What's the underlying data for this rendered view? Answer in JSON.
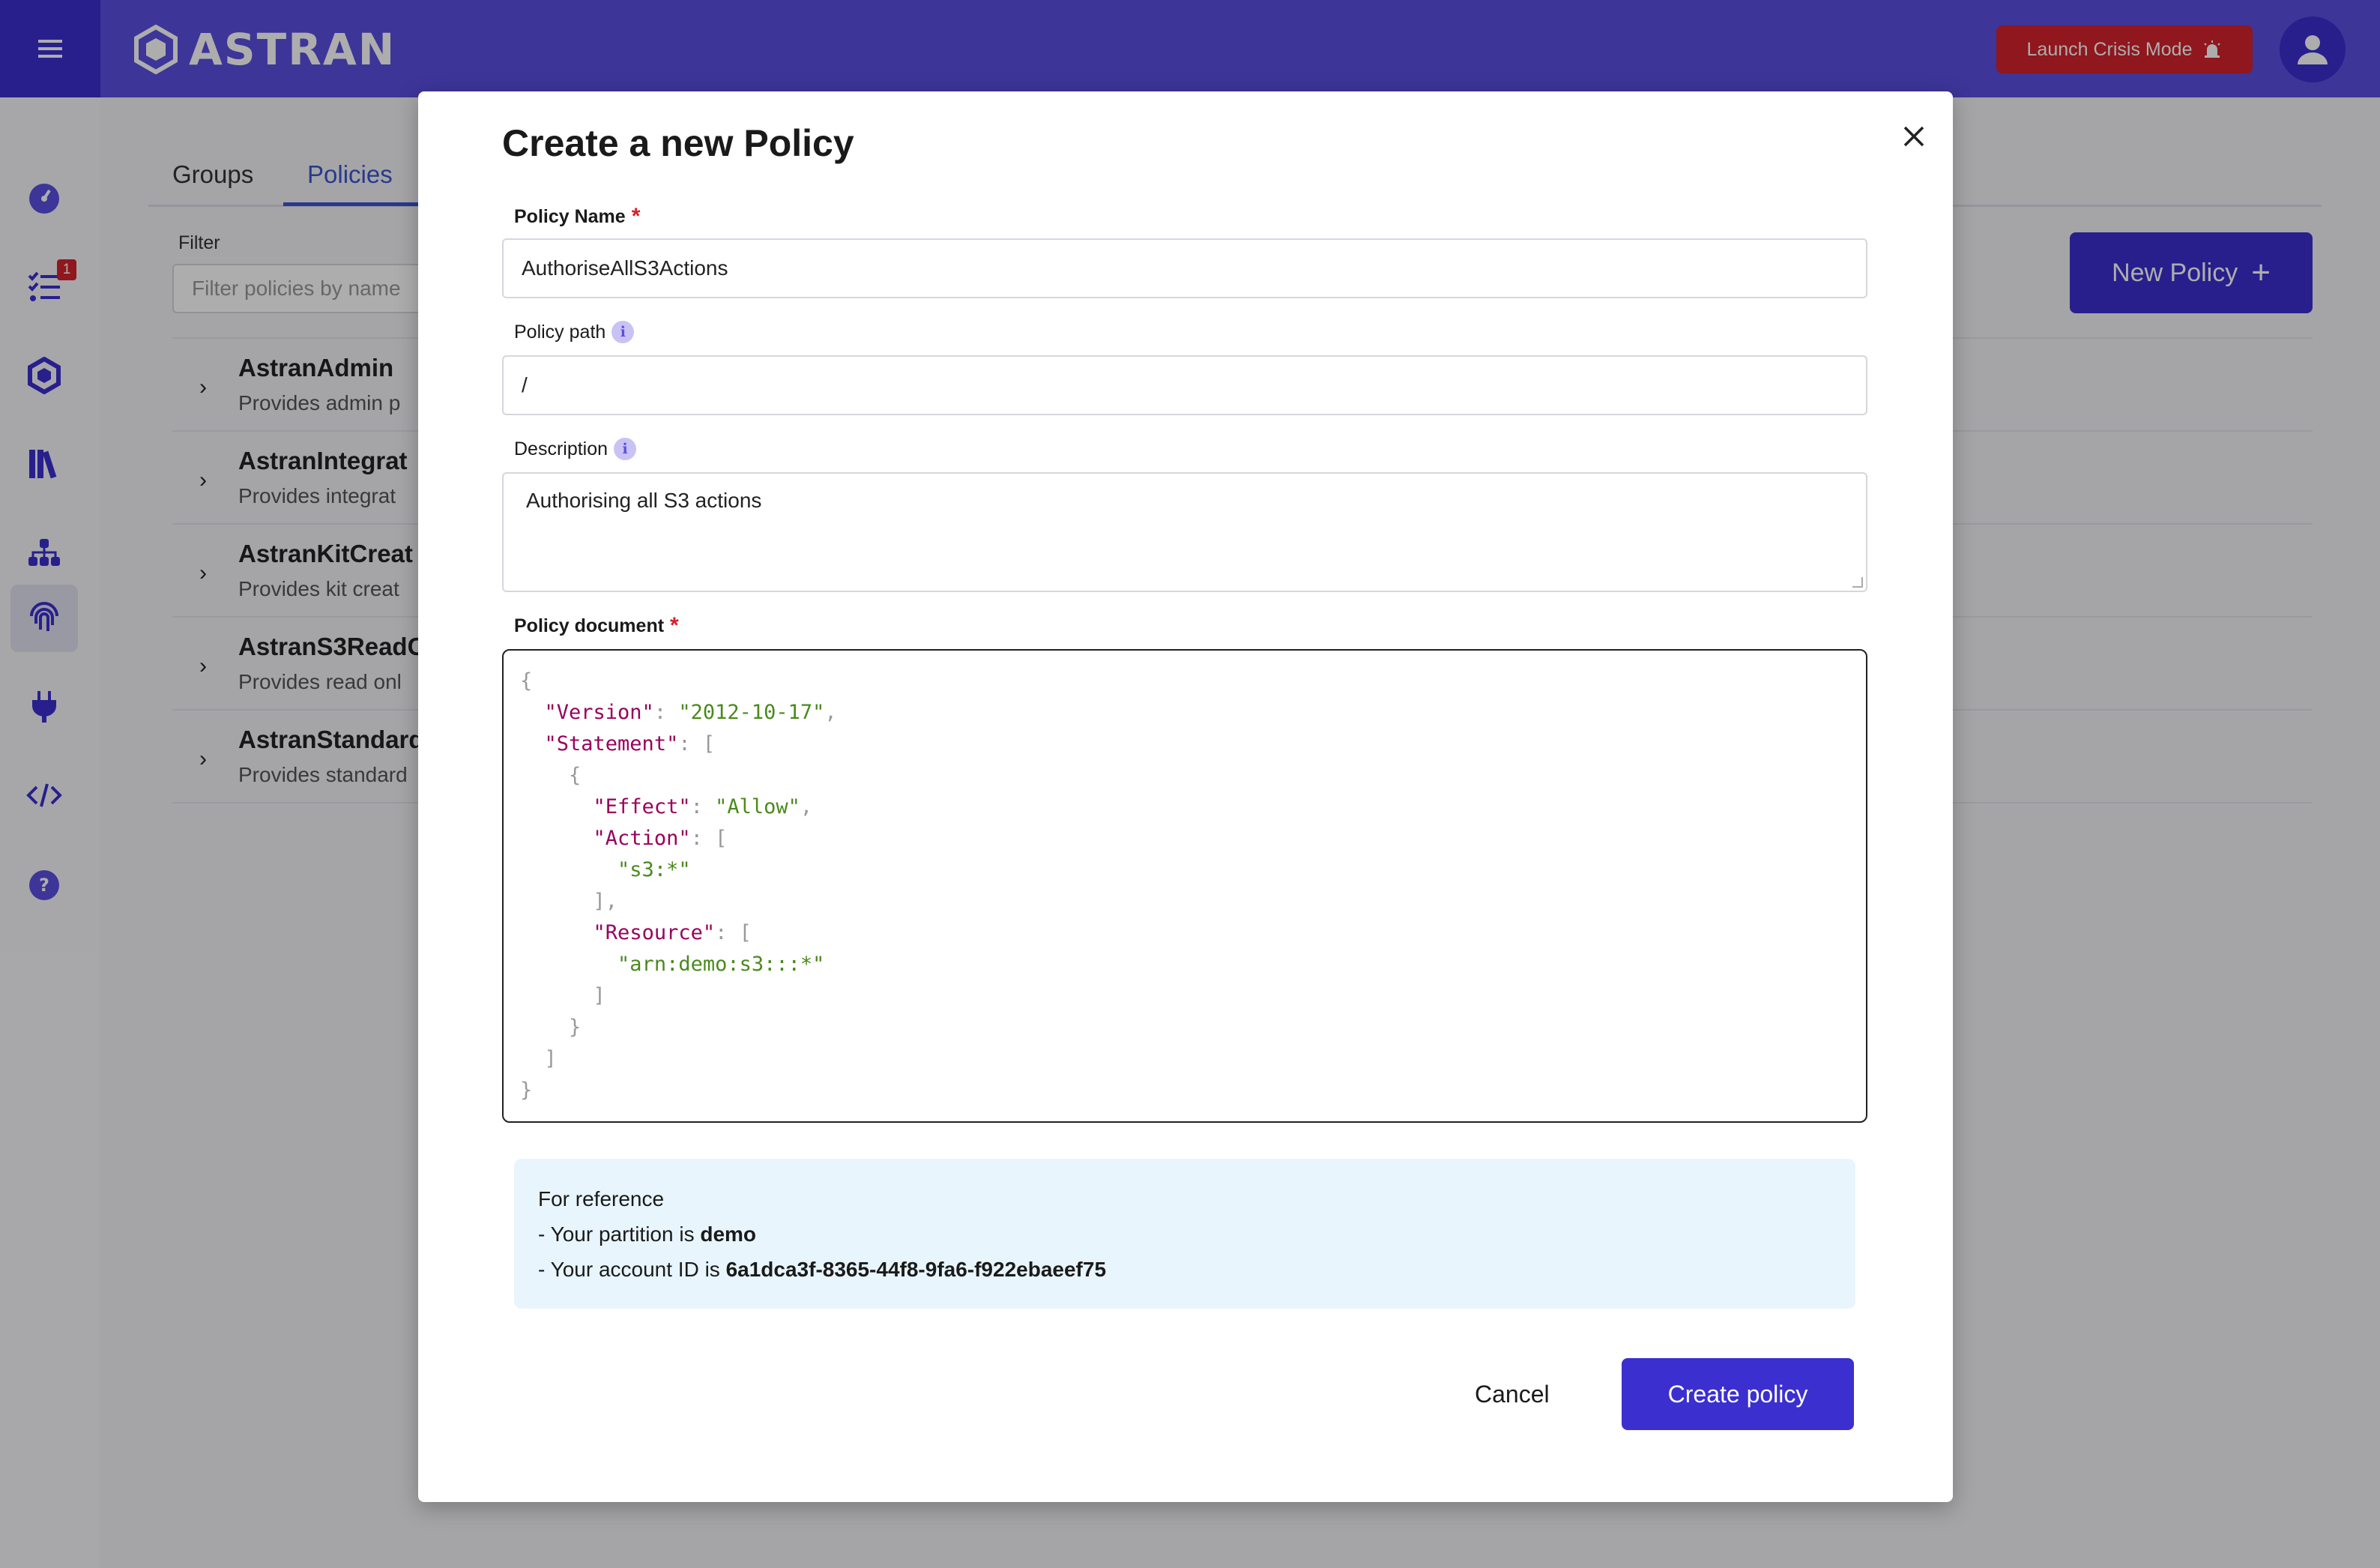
{
  "app": {
    "logo_text": "ASTRAN",
    "crisis_button": "Launch Crisis Mode"
  },
  "sidebar": {
    "items": [
      {
        "name": "dashboard",
        "icon": "gauge-icon"
      },
      {
        "name": "tasks",
        "icon": "checklist-icon",
        "badge": "1"
      },
      {
        "name": "kits",
        "icon": "hexagon-icon"
      },
      {
        "name": "library",
        "icon": "books-icon"
      },
      {
        "name": "organization",
        "icon": "hierarchy-icon"
      },
      {
        "name": "identity",
        "icon": "fingerprint-icon"
      },
      {
        "name": "integrations",
        "icon": "plug-icon"
      },
      {
        "name": "developer",
        "icon": "code-icon"
      },
      {
        "name": "help",
        "icon": "question-icon"
      }
    ]
  },
  "page": {
    "tabs": [
      "Groups",
      "Policies"
    ],
    "active_tab": "Policies",
    "filter": {
      "label": "Filter",
      "placeholder": "Filter policies by name"
    },
    "new_policy_button": "New Policy",
    "policies": [
      {
        "name": "AstranAdmin",
        "description": "Provides admin p"
      },
      {
        "name": "AstranIntegrat",
        "description": "Provides integrat"
      },
      {
        "name": "AstranKitCreat",
        "description": "Provides kit creat"
      },
      {
        "name": "AstranS3ReadC",
        "description": "Provides read onl"
      },
      {
        "name": "AstranStandard",
        "description": "Provides standard"
      }
    ]
  },
  "modal": {
    "title": "Create a new Policy",
    "policy_name": {
      "label": "Policy Name",
      "required_mark": "*",
      "value": "AuthoriseAllS3Actions"
    },
    "policy_path": {
      "label": "Policy path",
      "info": "i",
      "value": "/"
    },
    "description": {
      "label": "Description",
      "info": "i",
      "value": "Authorising all S3 actions"
    },
    "policy_document": {
      "label": "Policy document",
      "required_mark": "*",
      "version_value": "\"2012-10-17\"",
      "effect_value": "\"Allow\"",
      "action_value": "\"s3:*\"",
      "resource_value": "\"arn:demo:s3:::*\""
    },
    "reference": {
      "heading": "For reference",
      "partition_prefix": "- Your partition is ",
      "partition": "demo",
      "account_prefix": "- Your account ID is ",
      "account_id": "6a1dca3f-8365-44f8-9fa6-f922ebaeef75"
    },
    "cancel_button": "Cancel",
    "create_button": "Create policy"
  }
}
